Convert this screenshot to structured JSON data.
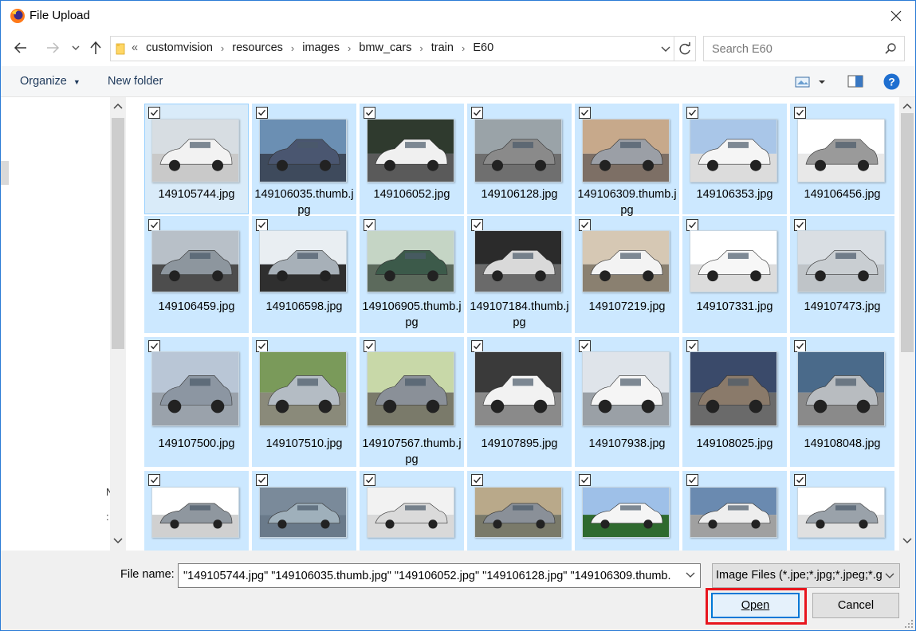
{
  "window": {
    "title": "File Upload"
  },
  "address": {
    "lead": "«",
    "crumbs": [
      "customvision",
      "resources",
      "images",
      "bmw_cars",
      "train",
      "E60"
    ]
  },
  "search": {
    "placeholder": "Search E60"
  },
  "toolbar": {
    "organize": "Organize",
    "new_folder": "New folder"
  },
  "nav_fragments": [
    "N",
    ":"
  ],
  "files": [
    {
      "name": "149105744.jpg"
    },
    {
      "name": "149106035.thumb.jpg"
    },
    {
      "name": "149106052.jpg"
    },
    {
      "name": "149106128.jpg"
    },
    {
      "name": "149106309.thumb.jpg"
    },
    {
      "name": "149106353.jpg"
    },
    {
      "name": "149106456.jpg"
    },
    {
      "name": "149106459.jpg"
    },
    {
      "name": "149106598.jpg"
    },
    {
      "name": "149106905.thumb.jpg"
    },
    {
      "name": "149107184.thumb.jpg"
    },
    {
      "name": "149107219.jpg"
    },
    {
      "name": "149107331.jpg"
    },
    {
      "name": "149107473.jpg"
    },
    {
      "name": "149107500.jpg"
    },
    {
      "name": "149107510.jpg"
    },
    {
      "name": "149107567.thumb.jpg"
    },
    {
      "name": "149107895.jpg"
    },
    {
      "name": "149107938.jpg"
    },
    {
      "name": "149108025.jpg"
    },
    {
      "name": "149108048.jpg"
    },
    {
      "name": ""
    },
    {
      "name": ""
    },
    {
      "name": ""
    },
    {
      "name": ""
    },
    {
      "name": ""
    },
    {
      "name": ""
    },
    {
      "name": ""
    }
  ],
  "file_name": {
    "label": "File name:",
    "value": "\"149105744.jpg\" \"149106035.thumb.jpg\" \"149106052.jpg\" \"149106128.jpg\" \"149106309.thumb."
  },
  "file_type": {
    "selected": "Image Files (*.jpe;*.jpg;*.jpeg;*.gif;*.png)"
  },
  "buttons": {
    "open": "Open",
    "cancel": "Cancel"
  },
  "colors": {
    "selection": "#cce8ff",
    "accent": "#0078d7",
    "highlight_box": "#e8151d"
  }
}
